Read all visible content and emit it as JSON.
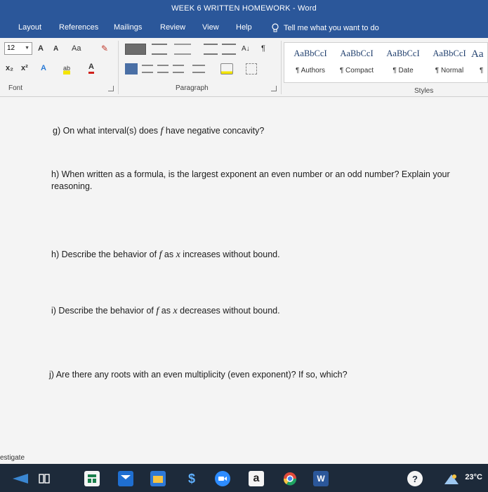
{
  "window": {
    "title": "WEEK 6 WRITTEN HOMEWORK  -  Word"
  },
  "ribbon_tabs": [
    "Layout",
    "References",
    "Mailings",
    "Review",
    "View",
    "Help"
  ],
  "tell_me": {
    "text": "Tell me what you want to do",
    "icon": "lightbulb-icon"
  },
  "font_group": {
    "font_size": "12",
    "grow_label": "A",
    "shrink_label": "A",
    "case_label": "Aa",
    "subscript_label": "x₂",
    "superscript_label": "x²",
    "effects_label": "A",
    "highlight_label": "ab",
    "color_label": "A",
    "group_label": "Font"
  },
  "paragraph_group": {
    "group_label": "Paragraph",
    "sort_label": "A↓",
    "pilcrow": "¶"
  },
  "styles_group": {
    "group_label": "Styles",
    "items": [
      {
        "sample": "AaBbCcI",
        "name": "¶ Authors"
      },
      {
        "sample": "AaBbCcI",
        "name": "¶ Compact"
      },
      {
        "sample": "AaBbCcI",
        "name": "¶ Date"
      },
      {
        "sample": "AaBbCcI",
        "name": "¶ Normal"
      },
      {
        "sample": "Aa",
        "name": "¶"
      }
    ]
  },
  "document": {
    "questions": [
      {
        "pre": "g) On what interval(s) does ",
        "var": "f",
        "post": " have negative concavity?"
      },
      {
        "pre": "h) When written as a formula, is the largest exponent an even number or an odd number? Explain your reasoning.",
        "var": "",
        "post": ""
      },
      {
        "pre": "h) Describe the behavior of ",
        "var": "f",
        "mid": " as ",
        "var2": "x",
        "post": " increases without bound."
      },
      {
        "pre": "i) Describe the behavior of ",
        "var": "f",
        "mid": " as ",
        "var2": "x",
        "post": " decreases without bound."
      },
      {
        "pre": "j) Are there any roots with an even multiplicity (even exponent)? If so, which?",
        "var": "",
        "post": ""
      }
    ]
  },
  "left_edge_text": "estigate",
  "taskbar": {
    "temperature": "23°C",
    "amazon_label": "a",
    "word_label": "W"
  },
  "colors": {
    "word_blue": "#2b579a",
    "taskbar": "#1d2a3a"
  }
}
